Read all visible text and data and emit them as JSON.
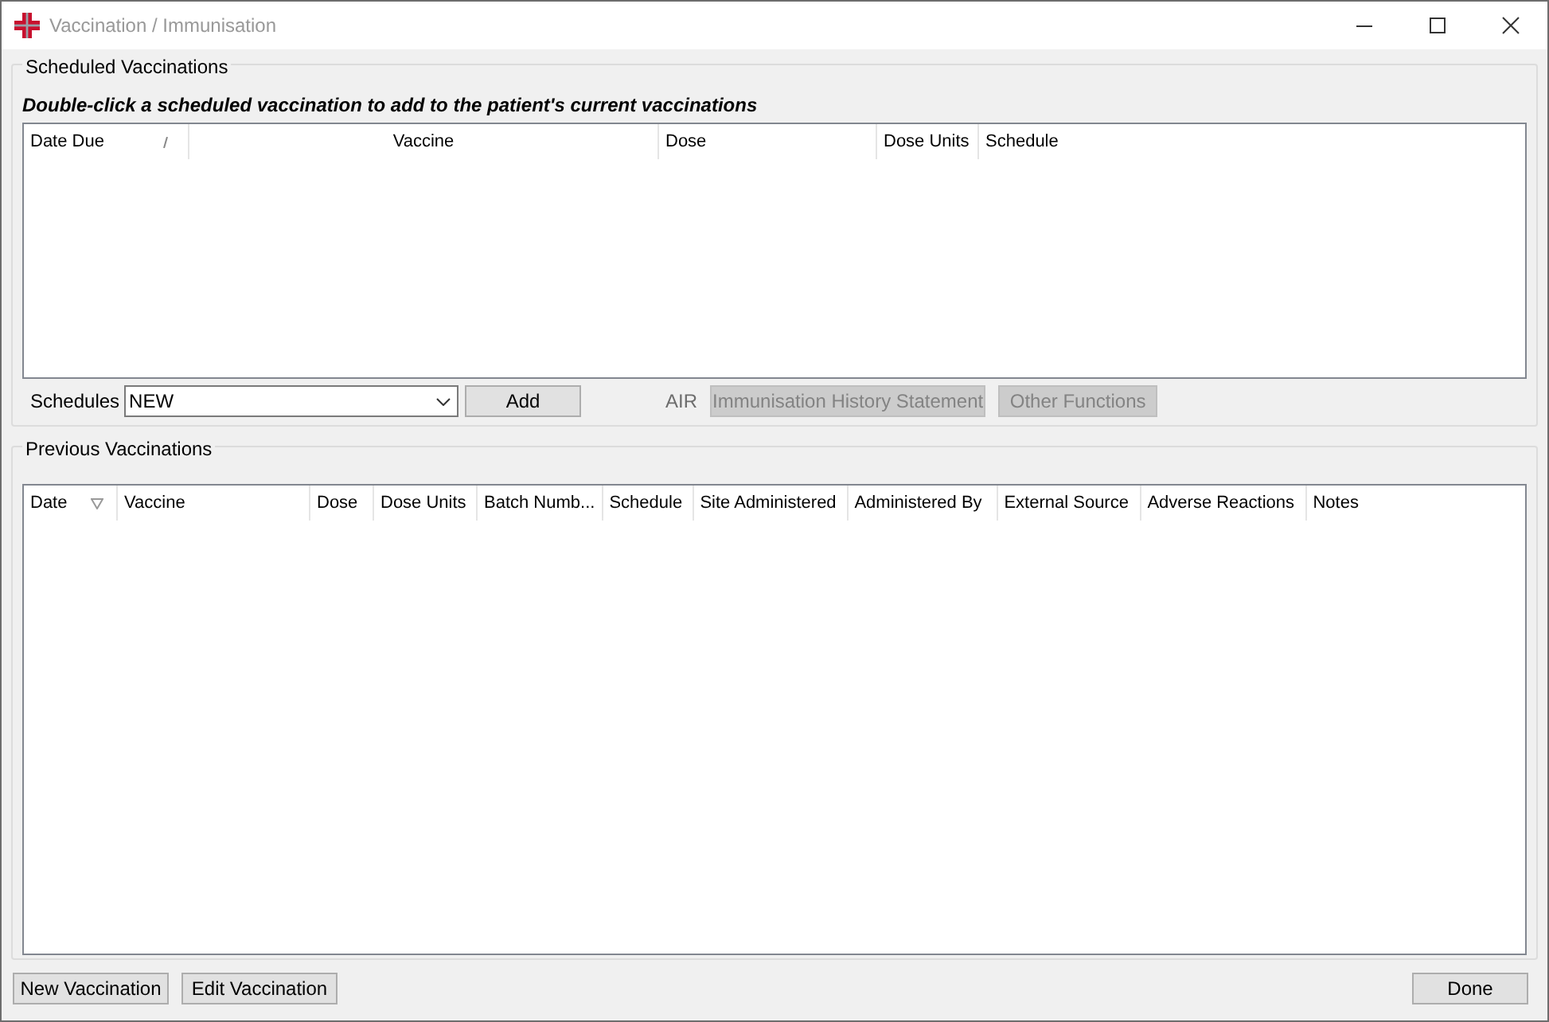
{
  "window": {
    "title": "Vaccination / Immunisation"
  },
  "scheduled": {
    "title": "Scheduled Vaccinations",
    "instruction": "Double-click a scheduled vaccination to add to the patient's current vaccinations",
    "columns": [
      {
        "label": "Date Due",
        "sorted": true
      },
      {
        "label": "Vaccine",
        "sorted": false
      },
      {
        "label": "Dose",
        "sorted": false
      },
      {
        "label": "Dose Units",
        "sorted": false
      },
      {
        "label": "Schedule",
        "sorted": false
      }
    ],
    "schedules_label": "Schedules",
    "schedules_value": "NEW",
    "add_button": "Add",
    "air_label": "AIR",
    "air_buttons": [
      {
        "label": "Immunisation History Statement",
        "disabled": true
      },
      {
        "label": "Other Functions",
        "disabled": true
      }
    ]
  },
  "previous": {
    "title": "Previous Vaccinations",
    "columns": [
      {
        "label": "Date",
        "sorted": true
      },
      {
        "label": "Vaccine",
        "sorted": false
      },
      {
        "label": "Dose",
        "sorted": false
      },
      {
        "label": "Dose Units",
        "sorted": false
      },
      {
        "label": "Batch Numb...",
        "sorted": false
      },
      {
        "label": "Schedule",
        "sorted": false
      },
      {
        "label": "Site Administered",
        "sorted": false
      },
      {
        "label": "Administered By",
        "sorted": false
      },
      {
        "label": "External Source",
        "sorted": false
      },
      {
        "label": "Adverse Reactions",
        "sorted": false
      },
      {
        "label": "Notes",
        "sorted": false
      }
    ]
  },
  "buttons": [
    "New Vaccination",
    "Edit Vaccination",
    "Done"
  ]
}
